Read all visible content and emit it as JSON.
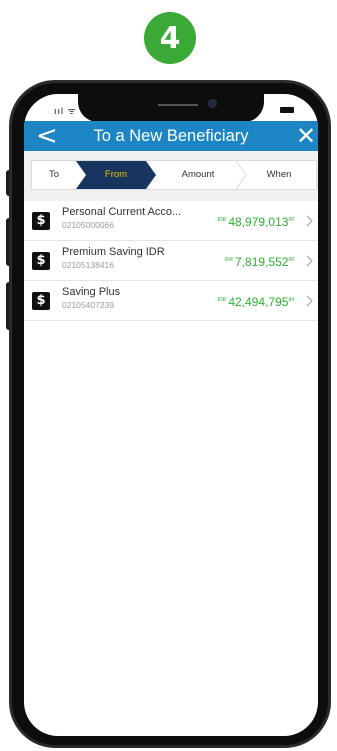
{
  "step_number": "4",
  "status_bar": {
    "signal": "ııl ᯤ"
  },
  "header": {
    "title": "To a New Beneficiary",
    "back_glyph": "<",
    "close_glyph": "✕"
  },
  "stepper": {
    "steps": [
      "To",
      "From",
      "Amount",
      "When"
    ],
    "active_step": "From"
  },
  "accounts": [
    {
      "name": "Personal Current Acco...",
      "number": "02105000066",
      "currency": "IDR",
      "amount": "48,979,013",
      "decimals": "00"
    },
    {
      "name": "Premium Saving IDR",
      "number": "02105138416",
      "currency": "IDR",
      "amount": "7,819,552",
      "decimals": "00"
    },
    {
      "name": "Saving Plus",
      "number": "02105407239",
      "currency": "IDR",
      "amount": "42,494,795",
      "decimals": "94"
    }
  ],
  "colors": {
    "header_blue": "#1d85c4",
    "active_step_bg": "#17355e",
    "active_step_text": "#f2c200",
    "balance_green": "#2bb12f",
    "badge_green": "#3aa935"
  },
  "icons": {
    "back": "chevron-left-icon",
    "close": "close-icon",
    "account_logo": "bank-logo-icon",
    "row_arrow": "chevron-right-icon"
  }
}
